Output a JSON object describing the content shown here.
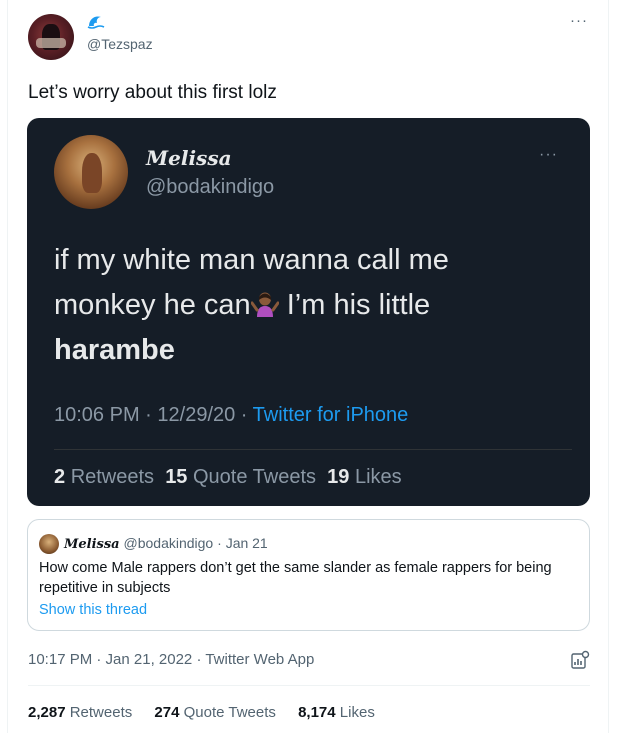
{
  "author": {
    "handle": "@Tezspaz",
    "avatar_icon": "profile-avatar",
    "badge_icon": "wave-icon"
  },
  "tweet": {
    "text": "Let’s worry about this first lolz"
  },
  "embedded_screenshot": {
    "display_name": "Melissa",
    "handle": "@bodakindigo",
    "line1": "if my white man wanna call me",
    "line2a": "monkey he can",
    "line2b": " I’m his little",
    "line3": "harambe",
    "emoji_icon": "person-shrugging-emoji",
    "time": "10:06 PM",
    "date": "12/29/20",
    "source": "Twitter for iPhone",
    "retweets_count": "2",
    "retweets_label": "Retweets",
    "quotes_count": "15",
    "quotes_label": "Quote Tweets",
    "likes_count": "19",
    "likes_label": "Likes"
  },
  "quoted_tweet": {
    "display_name": "Melissa",
    "handle": "@bodakindigo",
    "date": "Jan 21",
    "text": "How come Male rappers don’t get the same slander as female rappers for being repetitive in subjects",
    "show_thread": "Show this thread"
  },
  "meta": {
    "timestamp": "10:17 PM · Jan 21, 2022",
    "source": "Twitter Web App"
  },
  "stats": {
    "retweets_count": "2,287",
    "retweets_label": "Retweets",
    "quotes_count": "274",
    "quotes_label": "Quote Tweets",
    "likes_count": "8,174",
    "likes_label": "Likes"
  },
  "colors": {
    "accent": "#1d9bf0",
    "embed_bg": "#151d27"
  }
}
